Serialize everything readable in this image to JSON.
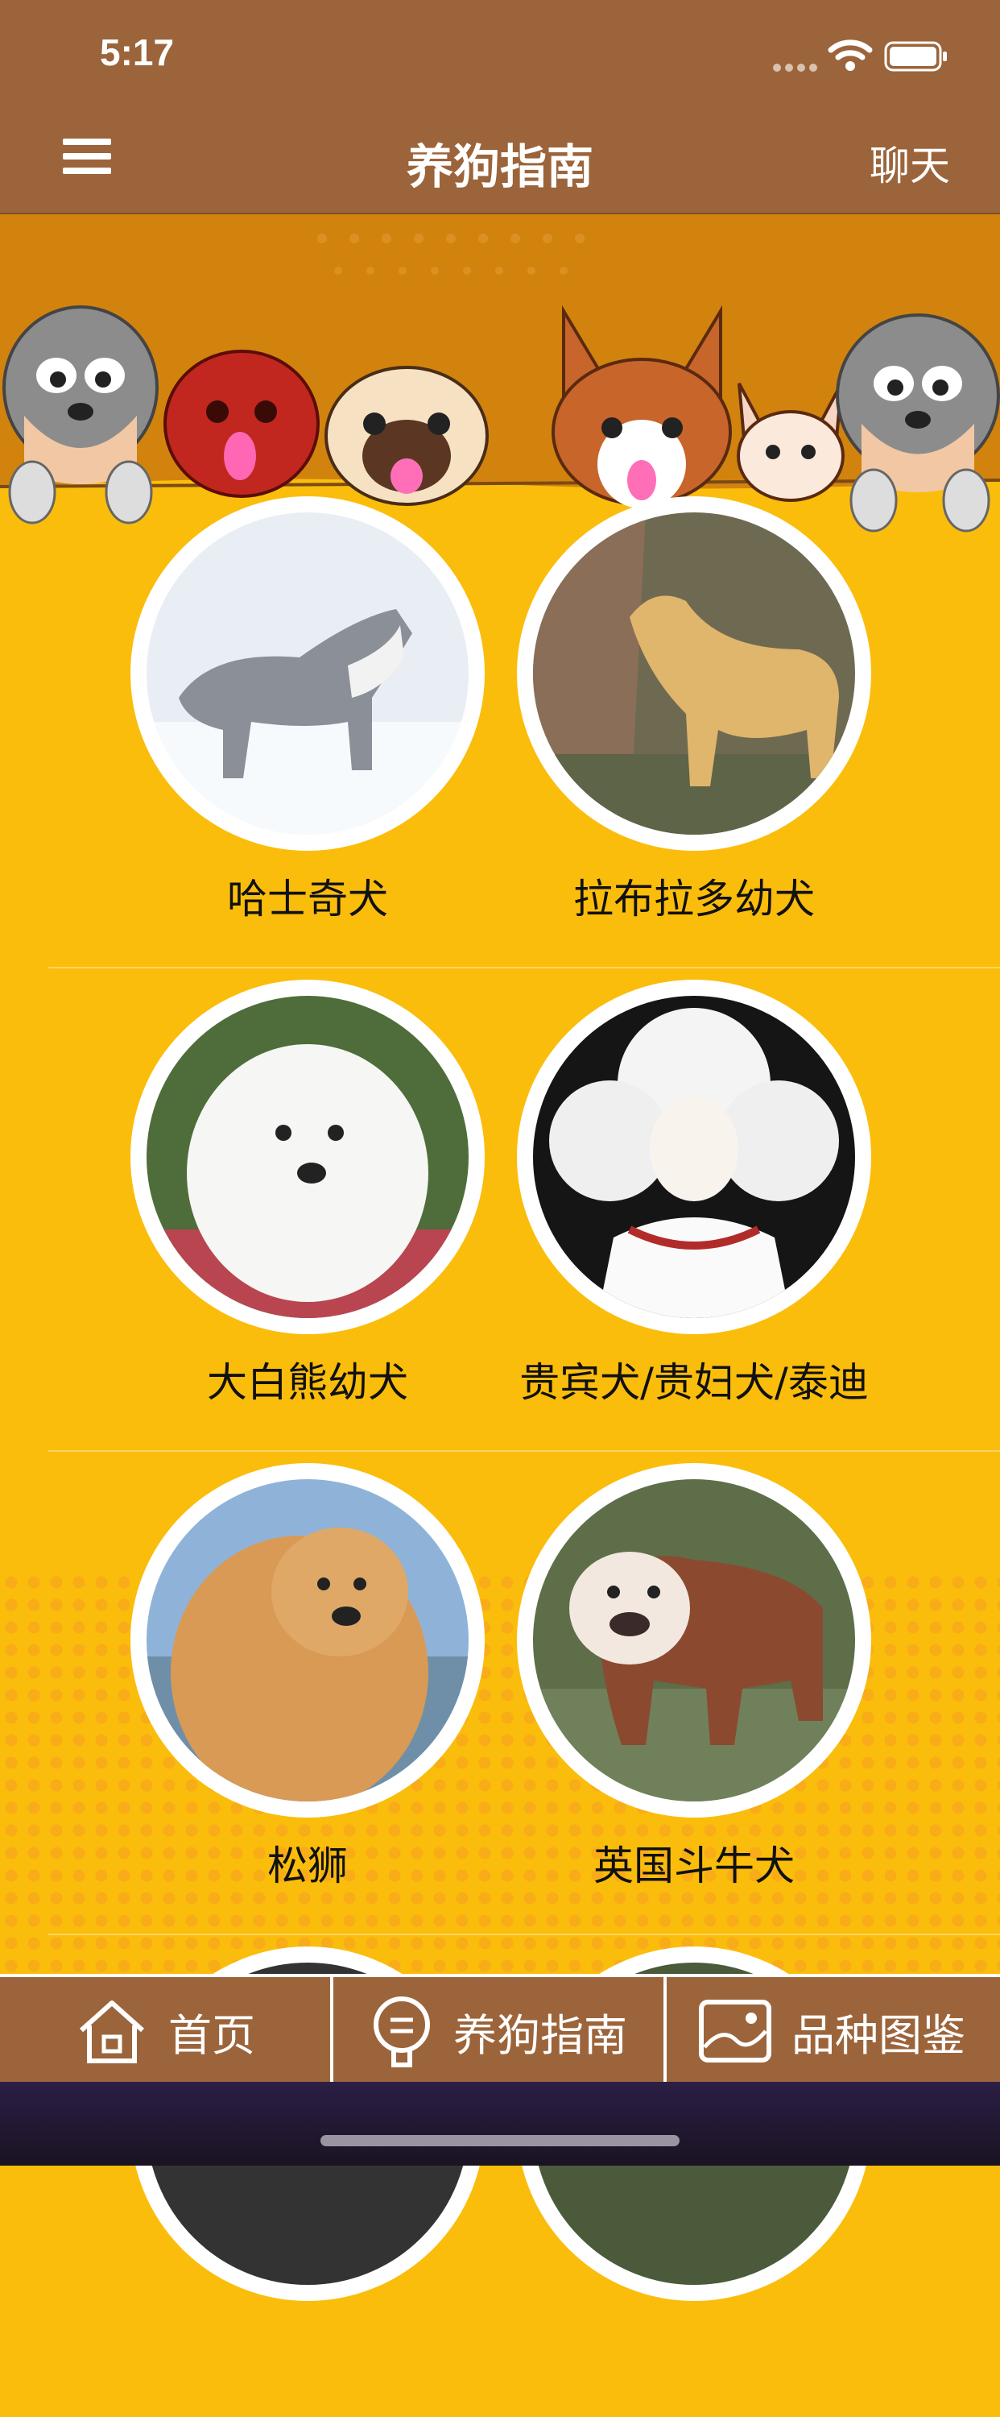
{
  "status_bar": {
    "time": "5:17"
  },
  "nav": {
    "title": "养狗指南",
    "chat_label": "聊天"
  },
  "dogs": [
    {
      "name": "哈士奇犬",
      "icon": "husky-photo"
    },
    {
      "name": "拉布拉多幼犬",
      "icon": "labrador-photo"
    },
    {
      "name": "大白熊幼犬",
      "icon": "great-pyrenees-photo"
    },
    {
      "name": "贵宾犬/贵妇犬/泰迪",
      "icon": "poodle-photo"
    },
    {
      "name": "松狮",
      "icon": "chow-chow-photo"
    },
    {
      "name": "英国斗牛犬",
      "icon": "bulldog-photo"
    }
  ],
  "tabs": [
    {
      "label": "首页",
      "icon": "home-icon"
    },
    {
      "label": "养狗指南",
      "icon": "guide-icon"
    },
    {
      "label": "品种图鉴",
      "icon": "gallery-icon"
    }
  ],
  "colors": {
    "header_brown": "#9c643a",
    "background_yellow": "#fbbd0b",
    "banner_orange": "#d2830e"
  }
}
